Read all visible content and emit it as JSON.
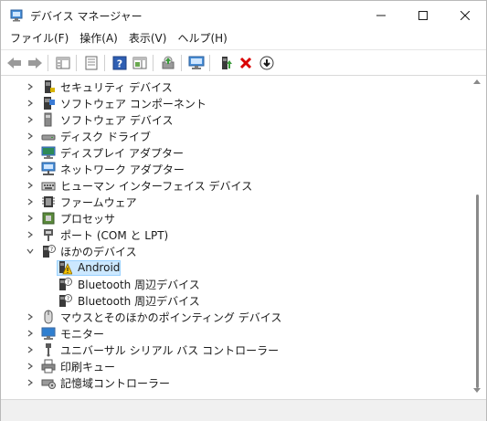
{
  "window": {
    "title": "デバイス マネージャー"
  },
  "menu": [
    "ファイル(F)",
    "操作(A)",
    "表示(V)",
    "ヘルプ(H)"
  ],
  "tree": [
    {
      "label": "セキュリティ デバイス",
      "icon": "security-device-icon",
      "expanded": false,
      "level": 0
    },
    {
      "label": "ソフトウェア コンポーネント",
      "icon": "software-component-icon",
      "expanded": false,
      "level": 0
    },
    {
      "label": "ソフトウェア デバイス",
      "icon": "software-device-icon",
      "expanded": false,
      "level": 0
    },
    {
      "label": "ディスク ドライブ",
      "icon": "disk-drive-icon",
      "expanded": false,
      "level": 0
    },
    {
      "label": "ディスプレイ アダプター",
      "icon": "display-adapter-icon",
      "expanded": false,
      "level": 0
    },
    {
      "label": "ネットワーク アダプター",
      "icon": "network-adapter-icon",
      "expanded": false,
      "level": 0
    },
    {
      "label": "ヒューマン インターフェイス デバイス",
      "icon": "hid-icon",
      "expanded": false,
      "level": 0
    },
    {
      "label": "ファームウェア",
      "icon": "firmware-icon",
      "expanded": false,
      "level": 0
    },
    {
      "label": "プロセッサ",
      "icon": "processor-icon",
      "expanded": false,
      "level": 0
    },
    {
      "label": "ポート (COM と LPT)",
      "icon": "port-icon",
      "expanded": false,
      "level": 0
    },
    {
      "label": "ほかのデバイス",
      "icon": "other-devices-icon",
      "expanded": true,
      "level": 0
    },
    {
      "label": "Android",
      "icon": "warning-device-icon",
      "level": 1,
      "selected": true
    },
    {
      "label": "Bluetooth 周辺デバイス",
      "icon": "unknown-device-icon",
      "level": 1
    },
    {
      "label": "Bluetooth 周辺デバイス",
      "icon": "unknown-device-icon",
      "level": 1
    },
    {
      "label": "マウスとそのほかのポインティング デバイス",
      "icon": "mouse-icon",
      "expanded": false,
      "level": 0
    },
    {
      "label": "モニター",
      "icon": "monitor-icon",
      "expanded": false,
      "level": 0
    },
    {
      "label": "ユニバーサル シリアル バス コントローラー",
      "icon": "usb-controller-icon",
      "expanded": false,
      "level": 0
    },
    {
      "label": "印刷キュー",
      "icon": "print-queue-icon",
      "expanded": false,
      "level": 0
    },
    {
      "label": "記憶域コントローラー",
      "icon": "storage-controller-icon",
      "expanded": false,
      "level": 0
    }
  ],
  "colors": {
    "selection_bg": "#cce8ff",
    "selection_border": "#99d1ff",
    "delete_red": "#d90000"
  }
}
